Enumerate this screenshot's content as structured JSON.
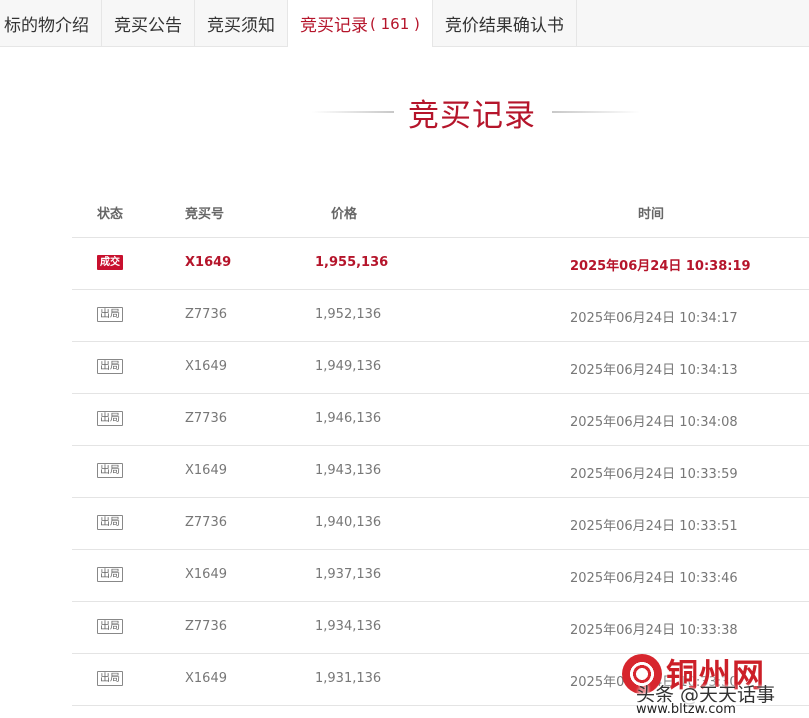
{
  "tabs": [
    {
      "label": "标的物介绍",
      "count": "",
      "active": false
    },
    {
      "label": "竞买公告",
      "count": "",
      "active": false
    },
    {
      "label": "竞买须知",
      "count": "",
      "active": false
    },
    {
      "label": "竞买记录",
      "count": "( 161 )",
      "active": true
    },
    {
      "label": "竞价结果确认书",
      "count": "",
      "active": false
    }
  ],
  "section_title": "竞买记录",
  "table": {
    "headers": {
      "status": "状态",
      "bidder": "竞买号",
      "price": "价格",
      "time": "时间"
    },
    "rows": [
      {
        "status": "成交",
        "bidder": "X1649",
        "price": "1,955,136",
        "time": "2025年06月24日 10:38:19",
        "winner": true
      },
      {
        "status": "出局",
        "bidder": "Z7736",
        "price": "1,952,136",
        "time": "2025年06月24日 10:34:17",
        "winner": false
      },
      {
        "status": "出局",
        "bidder": "X1649",
        "price": "1,949,136",
        "time": "2025年06月24日 10:34:13",
        "winner": false
      },
      {
        "status": "出局",
        "bidder": "Z7736",
        "price": "1,946,136",
        "time": "2025年06月24日 10:34:08",
        "winner": false
      },
      {
        "status": "出局",
        "bidder": "X1649",
        "price": "1,943,136",
        "time": "2025年06月24日 10:33:59",
        "winner": false
      },
      {
        "status": "出局",
        "bidder": "Z7736",
        "price": "1,940,136",
        "time": "2025年06月24日 10:33:51",
        "winner": false
      },
      {
        "status": "出局",
        "bidder": "X1649",
        "price": "1,937,136",
        "time": "2025年06月24日 10:33:46",
        "winner": false
      },
      {
        "status": "出局",
        "bidder": "Z7736",
        "price": "1,934,136",
        "time": "2025年06月24日 10:33:38",
        "winner": false
      },
      {
        "status": "出局",
        "bidder": "X1649",
        "price": "1,931,136",
        "time": "2025年06月24日 10:33:30",
        "winner": false
      }
    ]
  },
  "watermark": {
    "brand": "铜州网",
    "subtitle": "头条 @天天话事",
    "url": "www.bltzw.com"
  },
  "colors": {
    "accent": "#b5152b",
    "badge_win": "#c8102e"
  }
}
